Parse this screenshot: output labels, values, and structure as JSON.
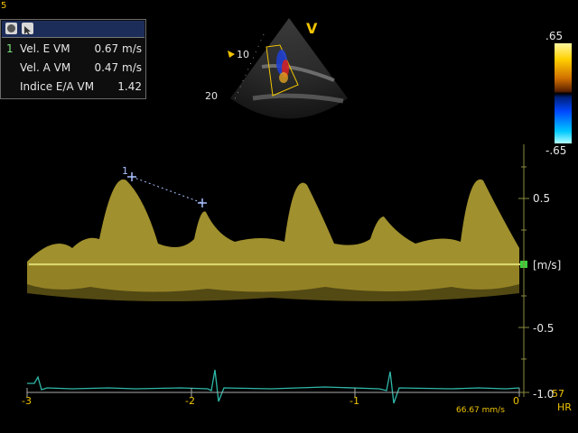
{
  "frame_number": "5",
  "measurement_panel": {
    "rows": [
      {
        "index": "1",
        "label": "Vel. E VM",
        "value": "0.67 m/s"
      },
      {
        "index": "",
        "label": "Vel. A VM",
        "value": "0.47 m/s"
      },
      {
        "index": "",
        "label": "Indice E/A VM",
        "value": "1.42"
      }
    ]
  },
  "color_scale": {
    "top": ".65",
    "bottom": "-.65"
  },
  "mode_label": "V",
  "depth_marks": {
    "d10": "10",
    "d20": "20"
  },
  "velocity_scale": {
    "p05": "0.5",
    "unit": "[m/s]",
    "m05": "-0.5",
    "m10": "-1.0"
  },
  "heart_rate": {
    "value": "57",
    "caption": "HR"
  },
  "time_scale": {
    "m3": "-3",
    "m2": "-2",
    "m1": "-1",
    "z": "0"
  },
  "sweep_speed": "66.67 mm/s",
  "cursor_number": "1",
  "colors": {
    "overlay_yellow": "#f0c400",
    "ecg": "#2fb8a8",
    "doppler": "#c8b43a",
    "caliper": "#a8c0ff"
  }
}
